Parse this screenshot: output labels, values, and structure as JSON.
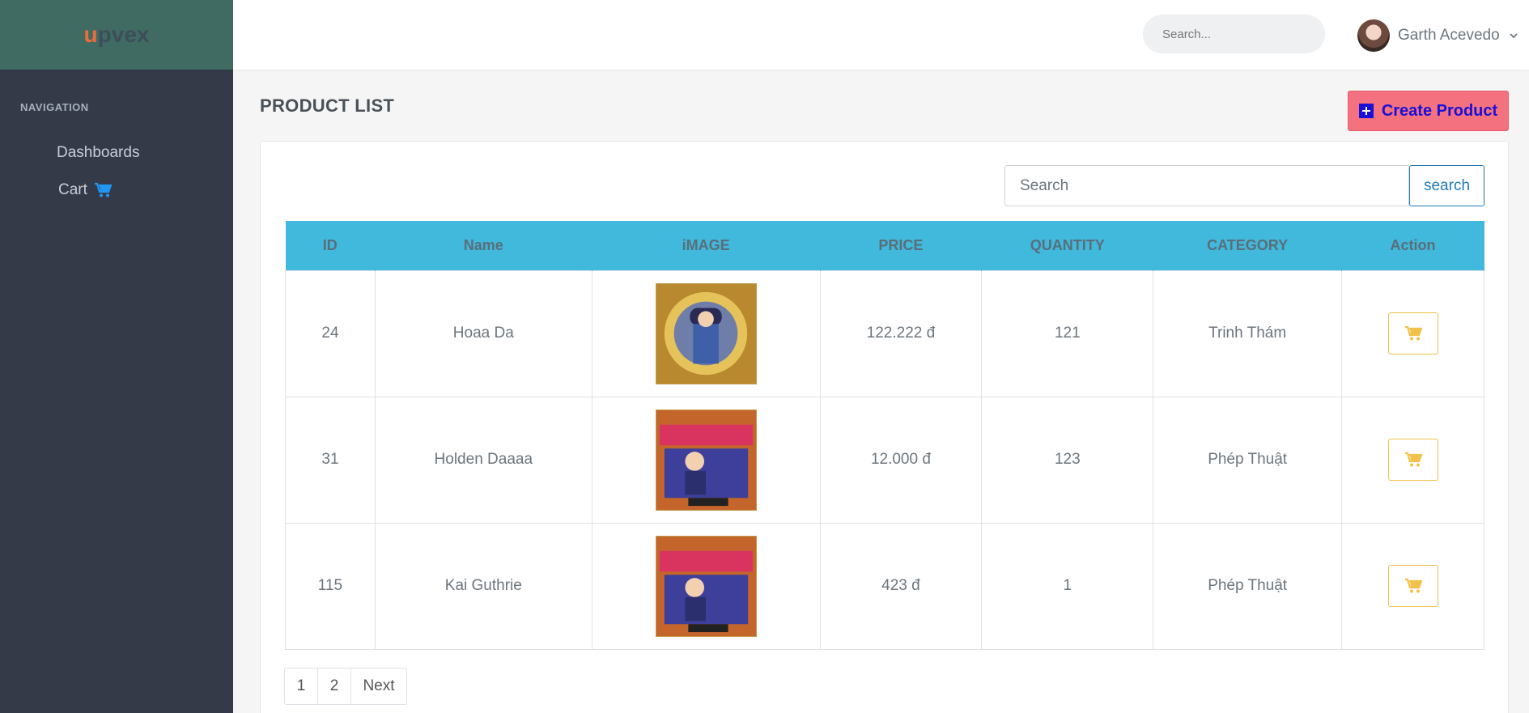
{
  "brand": {
    "logo_u": "u",
    "logo_rest": "pvex"
  },
  "sidebar": {
    "heading": "NAVIGATION",
    "items": [
      {
        "label": "Dashboards"
      },
      {
        "label": "Cart",
        "icon": "cart-icon"
      }
    ]
  },
  "header": {
    "search_placeholder": "Search...",
    "user_name": "Garth Acevedo"
  },
  "page": {
    "title": "PRODUCT LIST",
    "create_label": "Create Product"
  },
  "table_search": {
    "placeholder": "Search",
    "button_label": "search"
  },
  "table": {
    "headers": [
      "ID",
      "Name",
      "iMAGE",
      "PRICE",
      "QUANTITY",
      "CATEGORY",
      "Action"
    ],
    "rows": [
      {
        "id": "24",
        "name": "Hoaa Da",
        "price": "122.222 đ",
        "quantity": "121",
        "category": "Trinh Thám"
      },
      {
        "id": "31",
        "name": "Holden Daaaa",
        "price": "12.000 đ",
        "quantity": "123",
        "category": "Phép Thuật"
      },
      {
        "id": "115",
        "name": "Kai Guthrie",
        "price": "423 đ",
        "quantity": "1",
        "category": "Phép Thuật"
      }
    ]
  },
  "pagination": {
    "pages": [
      "1",
      "2"
    ],
    "next_label": "Next"
  },
  "colors": {
    "sidebar": "#343a48",
    "brand_bg": "#3f6b63",
    "table_header": "#40b9dc",
    "create_button": "#f4717f",
    "cart_accent": "#f1c24a",
    "link_blue": "#1f7ab8"
  }
}
